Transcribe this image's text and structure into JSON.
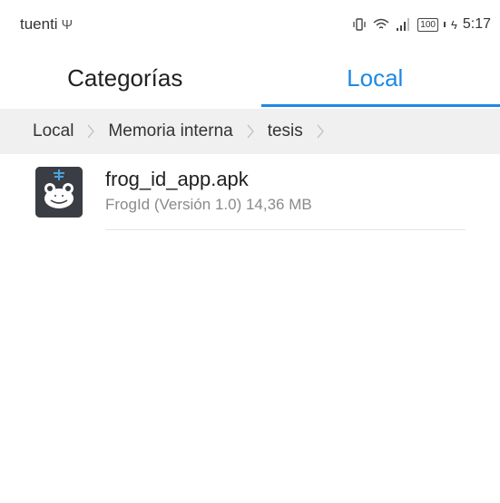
{
  "status_bar": {
    "carrier": "tuenti",
    "battery": "100",
    "time": "5:17"
  },
  "tabs": [
    {
      "label": "Categorías",
      "active": false
    },
    {
      "label": "Local",
      "active": true
    }
  ],
  "breadcrumb": [
    "Local",
    "Memoria interna",
    "tesis"
  ],
  "files": [
    {
      "name": "frog_id_app.apk",
      "meta": "FrogId (Versión 1.0) 14,36 MB",
      "icon": "frog-app-icon"
    }
  ],
  "colors": {
    "accent": "#1e88e5",
    "breadcrumb_bg": "#f0f0f0",
    "icon_bg": "#3a3e44"
  }
}
